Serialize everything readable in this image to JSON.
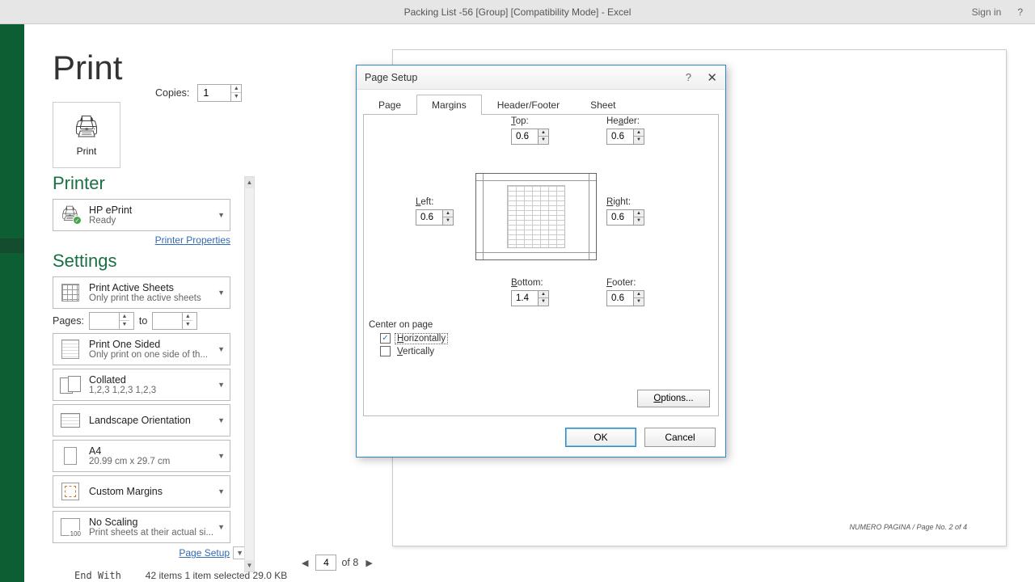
{
  "titlebar": {
    "title": "Packing List -56  [Group]  [Compatibility Mode]  -  Excel",
    "sign_in": "Sign in",
    "help": "?"
  },
  "print": {
    "heading": "Print",
    "button_label": "Print",
    "copies_label": "Copies:",
    "copies_value": "1"
  },
  "printer": {
    "section": "Printer",
    "name": "HP ePrint",
    "status": "Ready",
    "properties_link": "Printer Properties"
  },
  "settings": {
    "section": "Settings",
    "active_sheets": {
      "line1": "Print Active Sheets",
      "line2": "Only print the active sheets"
    },
    "pages_label": "Pages:",
    "pages_to": "to",
    "one_sided": {
      "line1": "Print One Sided",
      "line2": "Only print on one side of th..."
    },
    "collated": {
      "line1": "Collated",
      "line2": "1,2,3    1,2,3    1,2,3"
    },
    "orientation": {
      "line1": "Landscape Orientation"
    },
    "paper": {
      "line1": "A4",
      "line2": "20.99 cm x 29.7 cm"
    },
    "margins": {
      "line1": "Custom Margins"
    },
    "scaling": {
      "line1": "No Scaling",
      "line2": "Print sheets at their actual si...",
      "badge": "100"
    },
    "page_setup_link": "Page Setup"
  },
  "preview": {
    "page_label": "NUMERO PAGINA / Page No. 2 of 4"
  },
  "nav": {
    "current": "4",
    "total_label": "of 8"
  },
  "status": {
    "code": "End With",
    "items": "42 items    1 item selected  29.0 KB"
  },
  "dialog": {
    "title": "Page Setup",
    "tabs": {
      "page": "Page",
      "margins": "Margins",
      "header_footer": "Header/Footer",
      "sheet": "Sheet"
    },
    "labels": {
      "top": "Top:",
      "header": "Header:",
      "left": "Left:",
      "right": "Right:",
      "bottom": "Bottom:",
      "footer": "Footer:"
    },
    "values": {
      "top": "0.6",
      "header": "0.6",
      "left": "0.6",
      "right": "0.6",
      "bottom": "1.4",
      "footer": "0.6"
    },
    "center_title": "Center on page",
    "horizontally": "Horizontally",
    "vertically": "Vertically",
    "options": "Options...",
    "ok": "OK",
    "cancel": "Cancel"
  }
}
